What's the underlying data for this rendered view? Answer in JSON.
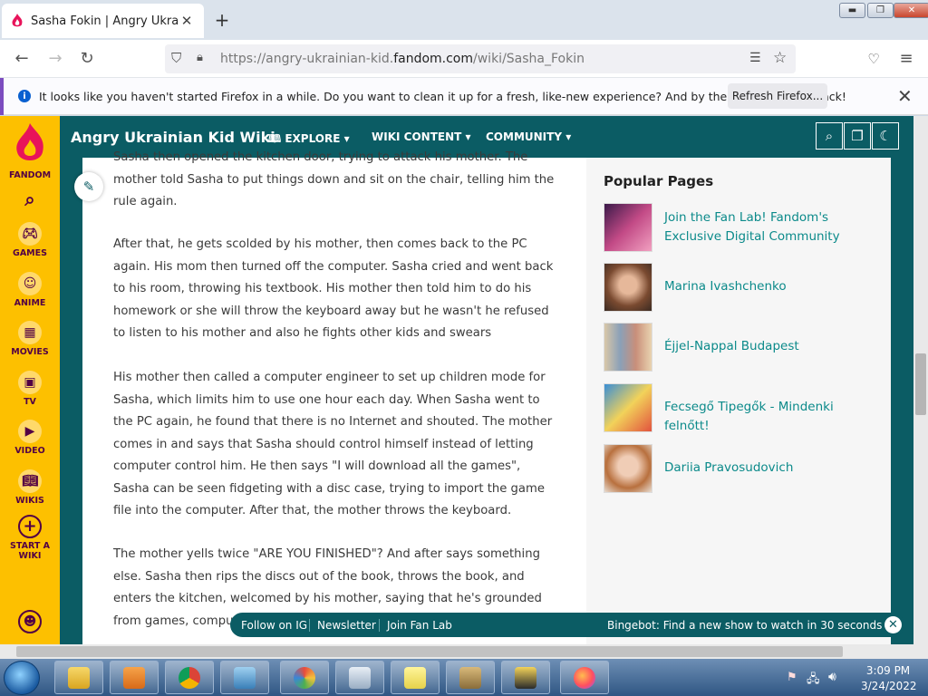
{
  "browser": {
    "tab_title": "Sasha Fokin | Angry Ukrainian Ki",
    "url_prefix": "https://angry-ukrainian-kid.",
    "url_domain": "fandom.com",
    "url_suffix": "/wiki/Sasha_Fokin"
  },
  "notification": {
    "message": "It looks like you haven't started Firefox in a while. Do you want to clean it up for a fresh, like-new experience? And by the way, welcome back!",
    "button": "Refresh Firefox..."
  },
  "fandom_sidebar": {
    "brand": "FANDOM",
    "items": [
      "GAMES",
      "ANIME",
      "MOVIES",
      "TV",
      "VIDEO",
      "WIKIS"
    ],
    "start_line1": "START A",
    "start_line2": "WIKI"
  },
  "wiki": {
    "title": "Angry Ukrainian Kid Wiki",
    "nav": [
      "EXPLORE",
      "WIKI CONTENT",
      "COMMUNITY"
    ]
  },
  "article": {
    "paragraphs": [
      "Sasha then opened the kitchen door, trying to attack his mother. The mother told Sasha to put things down and sit on the chair, telling him the rule again.",
      "After that, he gets scolded by his mother, then comes back to the PC again. His mom then turned off the computer. Sasha cried and went back to his room, throwing his textbook. His mother then told him to do his homework or she will throw the keyboard away but he wasn't he refused to listen to his mother and also he fights other kids and swears",
      "His mother then called a computer engineer to set up children mode for Sasha, which limits him to use one hour each day. When Sasha went to the PC again, he found that there is no Internet and shouted. The mother comes in and says that Sasha should control himself instead of letting computer control him. He then says \"I will download all the games\", Sasha can be seen fidgeting with a disc case, trying to import the game file into the computer. After that, the mother throws the keyboard.",
      "The mother yells twice \"ARE YOU FINISHED\"? And after says something else. Sasha then rips the discs out of the book, throws the book, and enters the kitchen, welcomed by his mother, saying that he's grounded from games, computer"
    ]
  },
  "popular": {
    "heading": "Popular Pages",
    "items": [
      "Join the Fan Lab! Fandom's Exclusive Digital Community",
      "Marina Ivashchenko",
      "Éjjel-Nappal Budapest",
      "Fecsegő Tipegők - Mindenki felnőtt!",
      "Dariia Pravosudovich"
    ]
  },
  "banner": {
    "links": [
      "Follow on IG",
      "Newsletter",
      "Join Fan Lab"
    ],
    "promo": "Bingebot: Find a new show to watch in 30 seconds"
  },
  "taskbar": {
    "time": "3:09 PM",
    "date": "3/24/2022"
  },
  "colors": {
    "fandom_yellow": "#fdc000",
    "wiki_teal": "#0b5c64",
    "link_teal": "#0b8a8a"
  }
}
